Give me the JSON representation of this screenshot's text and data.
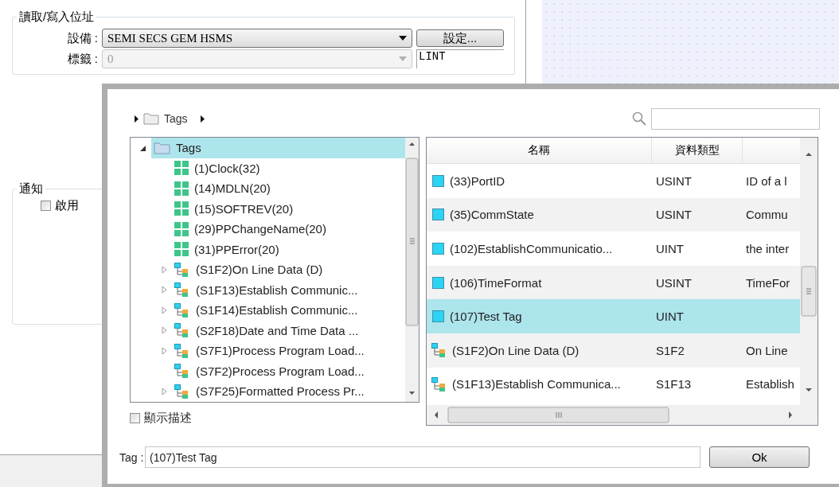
{
  "address_group": {
    "title": "讀取/寫入位址",
    "device": {
      "label": "設備 :",
      "value": "SEMI SECS GEM HSMS"
    },
    "settings_button": "設定...",
    "tag": {
      "label": "標籤 :",
      "value": "0",
      "disabled": true
    },
    "data_type": "LINT"
  },
  "notify_group": {
    "title": "通知",
    "enable": {
      "label": "啟用",
      "checked": false
    }
  },
  "dialog": {
    "breadcrumb": [
      "Tags"
    ],
    "tree": {
      "items": [
        {
          "label": "Tags",
          "kind": "folder",
          "expandable": true,
          "expanded": true,
          "selected": true,
          "children": [
            {
              "label": "(1)Clock(32)",
              "kind": "tag_group",
              "expandable": false,
              "selected": false
            },
            {
              "label": "(14)MDLN(20)",
              "kind": "tag_group",
              "expandable": false,
              "selected": false
            },
            {
              "label": "(15)SOFTREV(20)",
              "kind": "tag_group",
              "expandable": false,
              "selected": false
            },
            {
              "label": "(29)PPChangeName(20)",
              "kind": "tag_group",
              "expandable": false,
              "selected": false
            },
            {
              "label": "(31)PPError(20)",
              "kind": "tag_group",
              "expandable": false,
              "selected": false
            },
            {
              "label": "(S1F2)On Line Data (D)",
              "kind": "message",
              "expandable": true,
              "expanded": false,
              "selected": false
            },
            {
              "label": "(S1F13)Establish Communic...",
              "kind": "message",
              "expandable": true,
              "expanded": false,
              "selected": false
            },
            {
              "label": "(S1F14)Establish Communic...",
              "kind": "message",
              "expandable": true,
              "expanded": false,
              "selected": false
            },
            {
              "label": "(S2F18)Date and Time Data ...",
              "kind": "message",
              "expandable": true,
              "expanded": false,
              "selected": false
            },
            {
              "label": "(S7F1)Process Program Load...",
              "kind": "message",
              "expandable": true,
              "expanded": false,
              "selected": false
            },
            {
              "label": "(S7F2)Process Program Load...",
              "kind": "message",
              "expandable": false,
              "selected": false
            },
            {
              "label": "(S7F25)Formatted Process Pr...",
              "kind": "message",
              "expandable": true,
              "expanded": false,
              "selected": false
            }
          ]
        }
      ]
    },
    "show_description": {
      "label": "顯示描述",
      "checked": false
    },
    "table": {
      "columns": [
        "名稱",
        "資料類型"
      ],
      "rows": [
        {
          "kind": "tag",
          "name": "(33)PortID",
          "type": "USINT",
          "column_3": "ID of a l",
          "selected": false
        },
        {
          "kind": "tag",
          "name": "(35)CommState",
          "type": "USINT",
          "column_3": "Commu",
          "selected": false
        },
        {
          "kind": "tag",
          "name": "(102)EstablishCommunicatio...",
          "type": "UINT",
          "column_3": "the inter",
          "selected": false
        },
        {
          "kind": "tag",
          "name": "(106)TimeFormat",
          "type": "USINT",
          "column_3": "TimeFor",
          "selected": false
        },
        {
          "kind": "tag",
          "name": "(107)Test Tag",
          "type": "UINT",
          "selected": true
        },
        {
          "kind": "message",
          "name": "(S1F2)On Line Data (D)",
          "type": "S1F2",
          "column_3": "On Line",
          "selected": false
        },
        {
          "kind": "message",
          "name": "(S1F13)Establish Communica...",
          "type": "S1F13",
          "column_3": "Establish",
          "selected": false
        }
      ]
    },
    "tag_field": {
      "label": "Tag :",
      "value": "(107)Test Tag"
    },
    "ok_button": "Ok"
  }
}
